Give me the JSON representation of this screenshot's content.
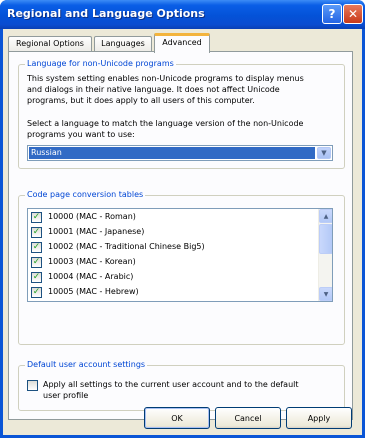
{
  "window": {
    "title": "Regional and Language Options",
    "help_label": "?",
    "close_label": "✕"
  },
  "tabs": [
    {
      "label": "Regional Options",
      "active": false
    },
    {
      "label": "Languages",
      "active": false
    },
    {
      "label": "Advanced",
      "active": true
    }
  ],
  "non_unicode": {
    "group_label": "Language for non-Unicode programs",
    "description": "This system setting enables non-Unicode programs to display menus and dialogs in their native language. It does not affect Unicode programs, but it does apply to all users of this computer.",
    "select_prompt": "Select a language to match the language version of the non-Unicode programs you want to use:",
    "selected_language": "Russian",
    "dropdown_icon": "chevron-down-icon"
  },
  "code_pages": {
    "group_label": "Code page conversion tables",
    "items": [
      {
        "label": "10000 (MAC - Roman)",
        "checked": true
      },
      {
        "label": "10001 (MAC - Japanese)",
        "checked": true
      },
      {
        "label": "10002 (MAC - Traditional Chinese Big5)",
        "checked": true
      },
      {
        "label": "10003 (MAC - Korean)",
        "checked": true
      },
      {
        "label": "10004 (MAC - Arabic)",
        "checked": true
      },
      {
        "label": "10005 (MAC - Hebrew)",
        "checked": true
      }
    ],
    "scroll_up_icon": "arrow-up-icon",
    "scroll_down_icon": "arrow-down-icon"
  },
  "default_user": {
    "group_label": "Default user account settings",
    "checkbox_label": "Apply all settings to the current user account and to the default user profile",
    "checked": false
  },
  "buttons": {
    "ok": "OK",
    "cancel": "Cancel",
    "apply": "Apply"
  },
  "colors": {
    "titlebar": "#0452d8",
    "accent_tab": "#f3b43d",
    "selection": "#316ac5",
    "group_label": "#0046d5",
    "client_bg": "#ece9d8"
  }
}
